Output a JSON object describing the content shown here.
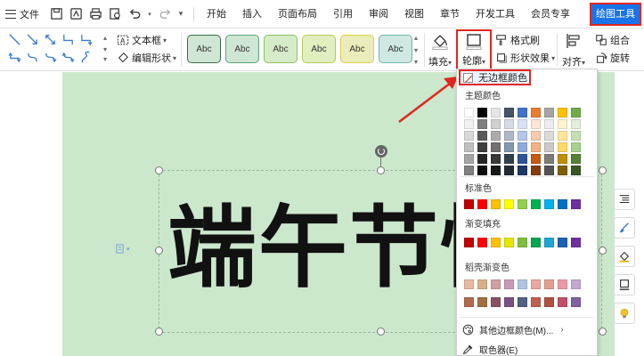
{
  "menubar": {
    "file_label": "文件",
    "tabs": [
      "开始",
      "插入",
      "页面布局",
      "引用",
      "审阅",
      "视图",
      "章节",
      "开发工具",
      "会员专享"
    ],
    "active_tab": "绘图工具"
  },
  "ribbon": {
    "textbox_label": "文本框",
    "edit_shape_label": "编辑形状",
    "style_label": "Abc",
    "fill_label": "填充",
    "outline_label": "轮廓",
    "format_brush_label": "格式刷",
    "shape_effect_label": "形状效果",
    "align_label": "对齐",
    "group_label": "组合",
    "rotate_label": "旋转"
  },
  "style_colors": [
    "#3a9b6a",
    "#3a9b6a",
    "#7bbf6a",
    "#a9c75a",
    "#d9c94a",
    "#6aa8a8"
  ],
  "canvas": {
    "big_text": "端午节快",
    "page_color": "#cbe7cc"
  },
  "dropdown": {
    "no_border_label": "无边框颜色",
    "theme_title": "主题颜色",
    "standard_title": "标准色",
    "gradient_title": "渐变填充",
    "shell_title": "稻壳渐变色",
    "more_colors_label": "其他边框颜色(M)...",
    "eyedropper_label": "取色器(E)",
    "more_arrow": "›",
    "theme_rows": [
      [
        "#ffffff",
        "#000000",
        "#e6e6e6",
        "#44546a",
        "#4472c4",
        "#ed7d31",
        "#a5a5a5",
        "#ffc000",
        "#70ad47"
      ],
      [
        "#f2f2f2",
        "#7f7f7f",
        "#d0d0d0",
        "#d6dce4",
        "#d9e2f3",
        "#fbe5d5",
        "#ededed",
        "#fff2cc",
        "#e2efda"
      ],
      [
        "#d8d8d8",
        "#595959",
        "#aeabab",
        "#adb9ca",
        "#b4c6e7",
        "#f7cbac",
        "#dbdbdb",
        "#fee599",
        "#c6e0b4"
      ],
      [
        "#bfbfbf",
        "#3f3f3f",
        "#757070",
        "#8497b0",
        "#8eaadb",
        "#f4b183",
        "#c9c9c9",
        "#ffd965",
        "#a9d18e"
      ],
      [
        "#a5a5a5",
        "#262626",
        "#3a3838",
        "#323f4f",
        "#2f5496",
        "#c55a11",
        "#7b7b7b",
        "#bf8f00",
        "#538135"
      ],
      [
        "#7f7f7f",
        "#0c0c0c",
        "#171616",
        "#222a35",
        "#1f3864",
        "#833c0b",
        "#525252",
        "#7f6000",
        "#375623"
      ]
    ],
    "standard_colors": [
      "#c00000",
      "#ff0000",
      "#ffc000",
      "#ffff00",
      "#92d050",
      "#00b050",
      "#00b0f0",
      "#0070c0",
      "#7030a0"
    ],
    "gradient_colors": [
      "#c00000",
      "#ff0000",
      "#ffc000",
      "#e5e500",
      "#7fbf3f",
      "#00a650",
      "#1fa5d6",
      "#1e5fb0",
      "#7030a0"
    ],
    "shell_rows": [
      [
        "#e8b9a0",
        "#d7b08a",
        "#cfa0a0",
        "#c89ab8",
        "#b0c4e0",
        "#e9a7a0",
        "#e0a090",
        "#e89aa8",
        "#c4a8d0"
      ],
      [
        "#b06a50",
        "#a07040",
        "#8a5060",
        "#7a5080",
        "#506080",
        "#c06050",
        "#b05040",
        "#c05068",
        "#8060a0"
      ]
    ]
  }
}
